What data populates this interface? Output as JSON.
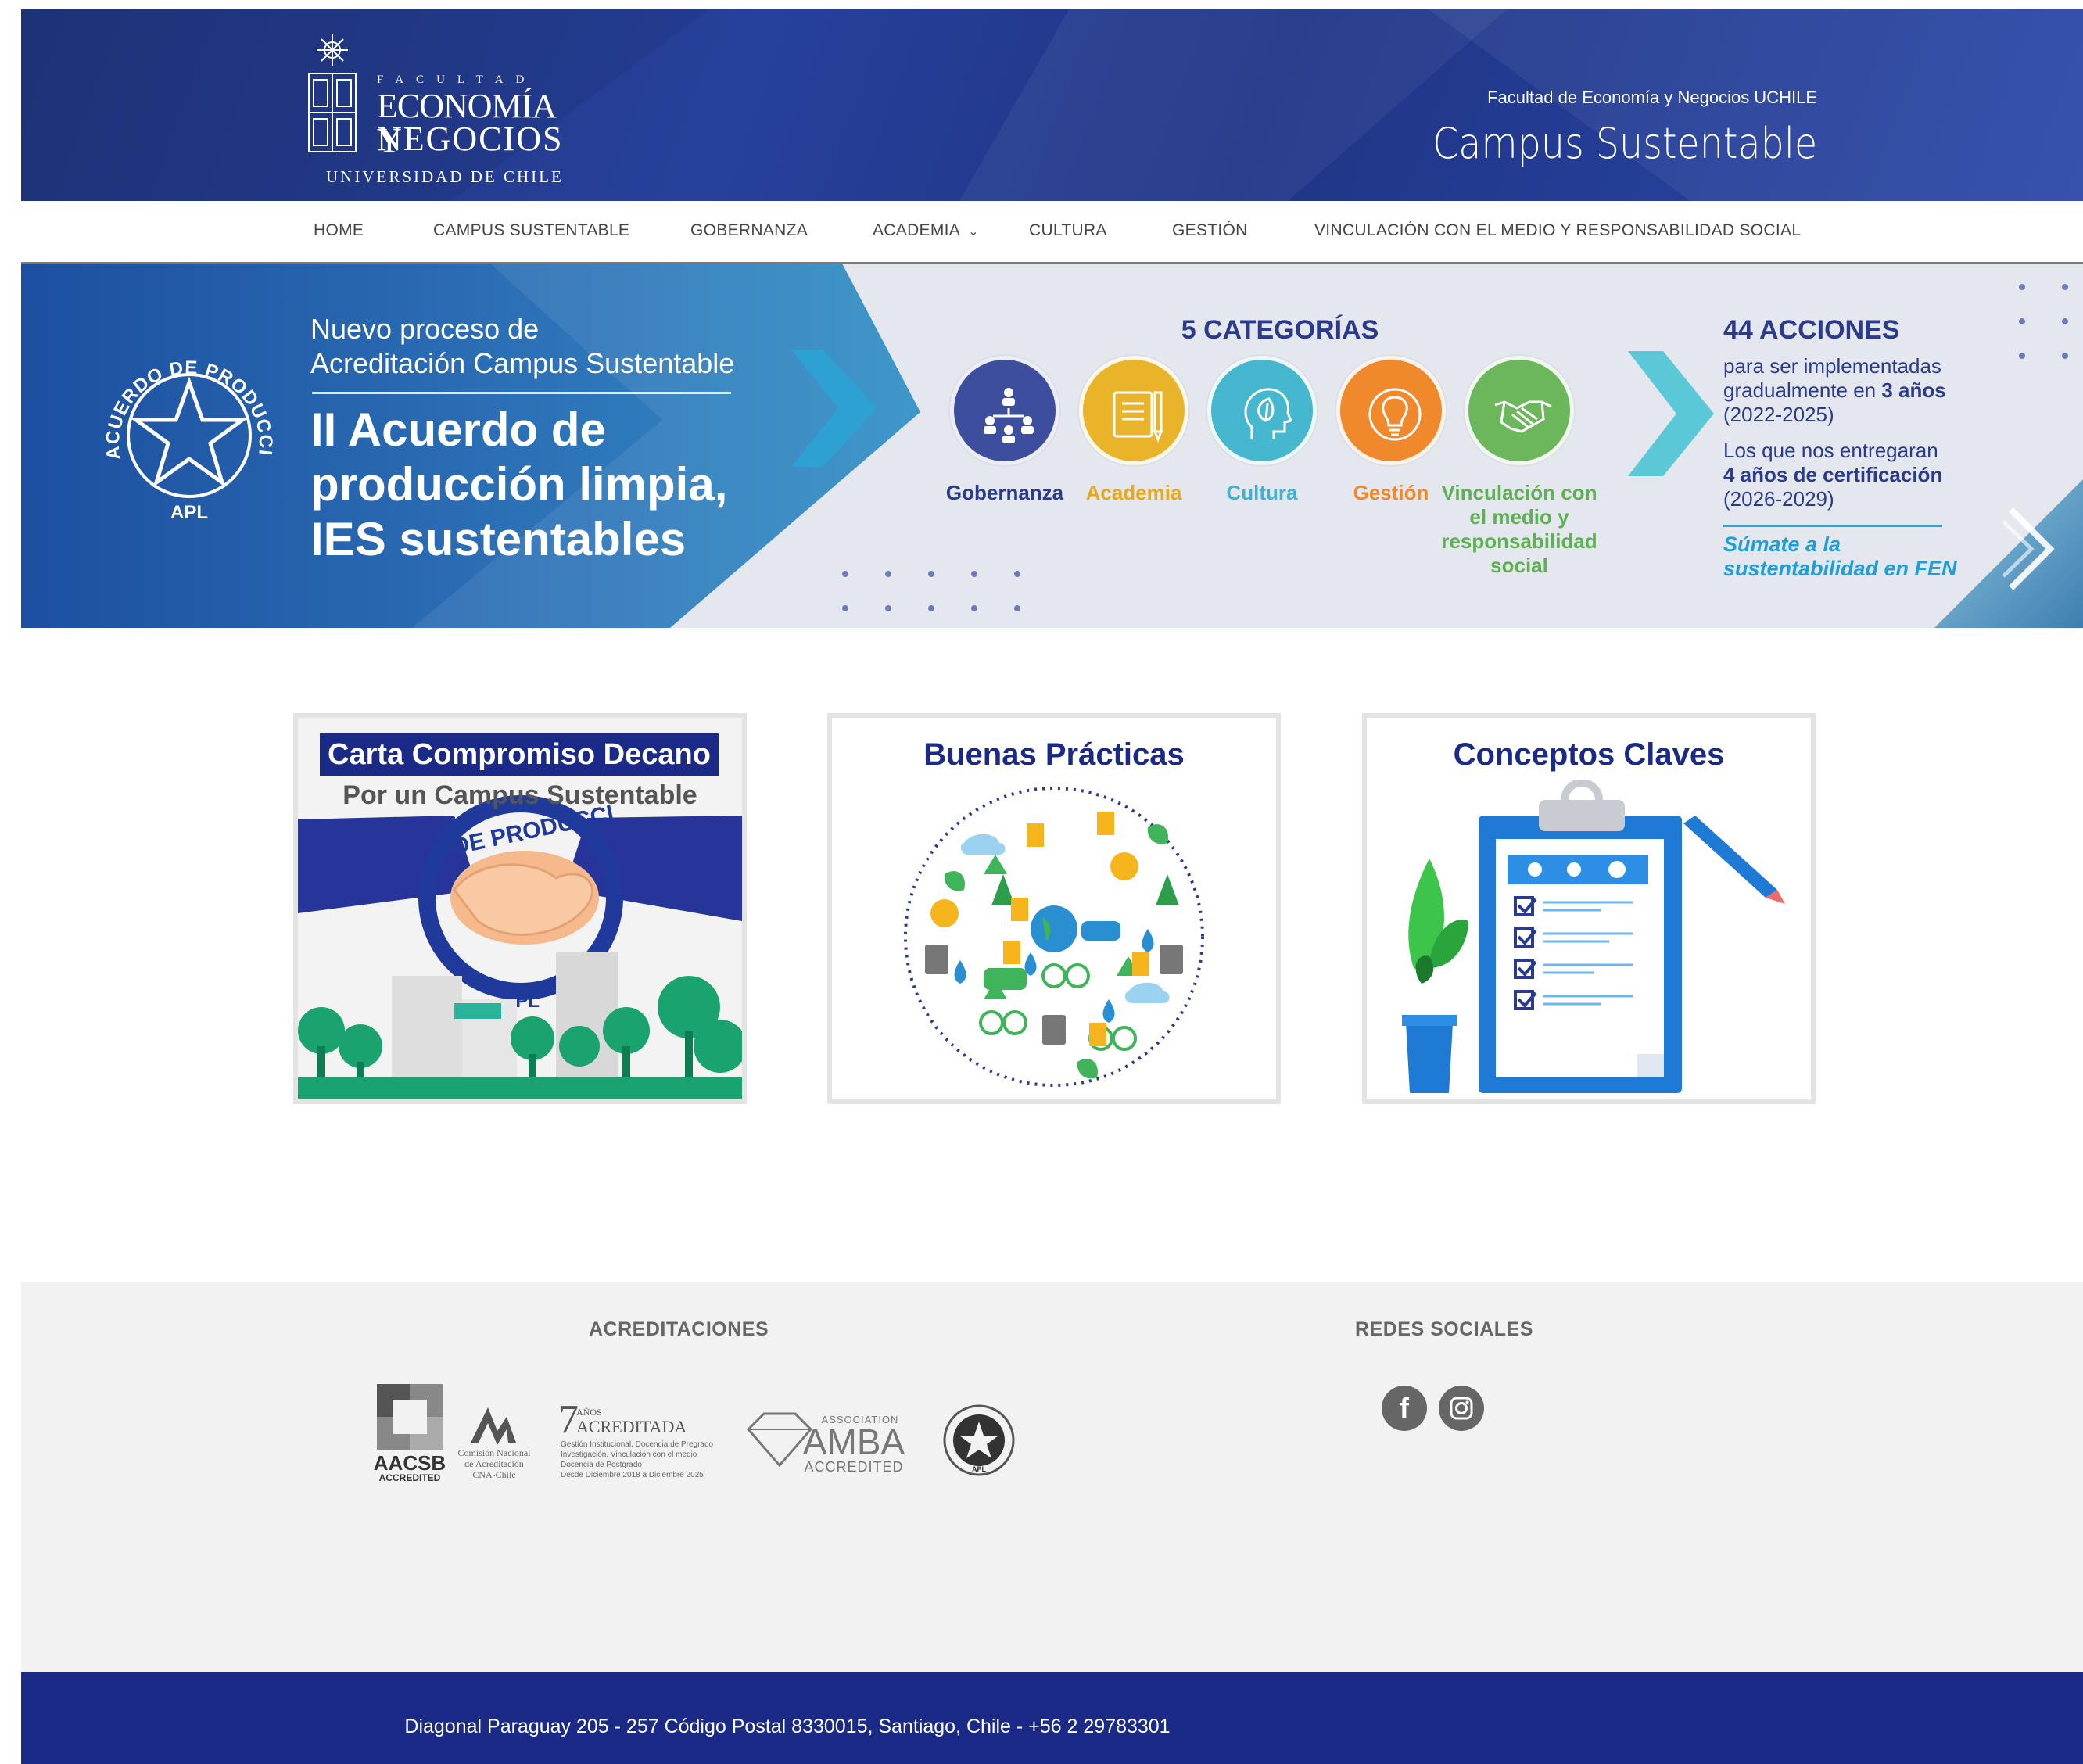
{
  "header": {
    "logo": {
      "facultad": "FACULTAD",
      "line1": "ECONOMÍA Y",
      "line2": "NEGOCIOS",
      "university": "UNIVERSIDAD DE CHILE"
    },
    "subtitle": "Facultad de Economía y Negocios UCHILE",
    "title": "Campus Sustentable",
    "background_color": "#223a8f"
  },
  "nav": {
    "items": [
      {
        "label": "HOME"
      },
      {
        "label": "CAMPUS SUSTENTABLE"
      },
      {
        "label": "GOBERNANZA"
      },
      {
        "label": "ACADEMIA",
        "has_dropdown": true
      },
      {
        "label": "CULTURA"
      },
      {
        "label": "GESTIÓN"
      },
      {
        "label": "VINCULACIÓN CON EL MEDIO Y RESPONSABILIDAD SOCIAL"
      }
    ]
  },
  "banner": {
    "seal_text": "ACUERDO DE PRODUCCIÓN LIMPIA",
    "seal_abbr": "APL",
    "intro_line1": "Nuevo proceso de",
    "intro_line2": "Acreditación Campus Sustentable",
    "headline_line1": "II Acuerdo de",
    "headline_line2": "producción limpia,",
    "headline_line3": "IES sustentables",
    "categories_title": "5 CATEGORÍAS",
    "categories": [
      {
        "label": "Gobernanza",
        "color": "#3d4e9e",
        "icon": "people-network-icon"
      },
      {
        "label": "Academia",
        "color": "#e9b32a",
        "icon": "book-icon"
      },
      {
        "label": "Cultura",
        "color": "#45b7cf",
        "icon": "head-leaf-icon"
      },
      {
        "label": "Gestión",
        "color": "#f0892c",
        "icon": "lightbulb-icon"
      },
      {
        "label": "Vinculación con el medio y responsabilidad social",
        "color": "#6cb75c",
        "icon": "handshake-icon"
      }
    ],
    "actions_title": "44 ACCIONES",
    "actions_p1a": "para ser implementadas",
    "actions_p1b": "gradualmente en",
    "actions_p1b_bold": "3 años",
    "actions_p1c": "(2022-2025)",
    "actions_p2a": "Los que nos entregaran",
    "actions_p2b_bold": "4 años de certificación",
    "actions_p2c": "(2026-2029)",
    "cta_line1": "Súmate a la",
    "cta_line2": "sustentabilidad en FEN"
  },
  "cards": [
    {
      "title": "Carta Compromiso Decano",
      "subtitle": "Por un Campus Sustentable",
      "seal_text": "DE PRODUCCI",
      "seal_abbr": "APL"
    },
    {
      "title": "Buenas Prácticas"
    },
    {
      "title": "Conceptos Claves"
    }
  ],
  "footer": {
    "accreditations_heading": "ACREDITACIONES",
    "social_heading": "REDES SOCIALES",
    "accreditation_logos": {
      "aacsb": "AACSB",
      "aacsb_sub": "ACCREDITED",
      "cna_line1": "Comisión Nacional",
      "cna_line2": "de Acreditación",
      "cna_line3": "CNA-Chile",
      "cna_years": "7",
      "cna_years_label": "AÑOS",
      "cna_acreditada": "ACREDITADA",
      "cna_detail1": "Gestión Institucional, Docencia de Pregrado",
      "cna_detail2": "Investigación, Vinculación con el medio",
      "cna_detail3": "Docencia de Postgrado",
      "cna_detail4": "Desde Diciembre 2018 a Diciembre 2025",
      "amba": "AMBA",
      "amba_top": "ASSOCIATION",
      "amba_sub": "ACCREDITED",
      "apl": "APL"
    },
    "social": [
      {
        "name": "facebook",
        "glyph": "f"
      },
      {
        "name": "instagram"
      }
    ],
    "address": "Diagonal Paraguay 205 - 257 Código Postal 8330015, Santiago, Chile - +56 2 29783301",
    "bottom_color": "#1b2a86"
  }
}
